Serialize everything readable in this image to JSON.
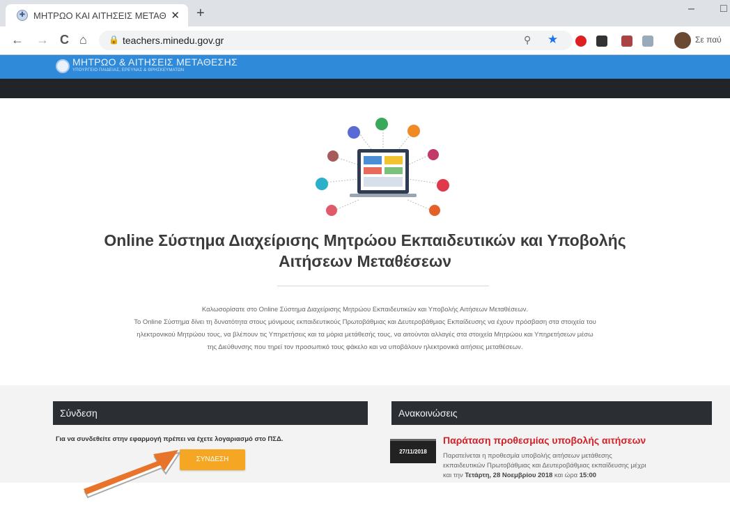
{
  "browser": {
    "tab_title": "ΜΗΤΡΩΟ ΚΑΙ ΑΙΤΗΣΕΙΣ ΜΕΤΑΘΕ",
    "tab_close": "✕",
    "new_tab": "+",
    "minimize": "–",
    "maximize": "□",
    "back": "←",
    "forward": "→",
    "reload": "C",
    "home": "⌂",
    "url": "teachers.minedu.gov.gr",
    "lock": "🔒",
    "search_icon": "⚲",
    "bookmark_star": "★",
    "profile_name": "Σε παύ"
  },
  "site": {
    "header_title": "ΜΗΤΡΩΟ & ΑΙΤΗΣΕΙΣ ΜΕΤΑΘΕΣΗΣ",
    "header_subtitle": "ΥΠΟΥΡΓΕΙΟ ΠΑΙΔΕΙΑΣ, ΕΡΕΥΝΑΣ & ΘΡΗΣΚΕΥΜΑΤΩΝ",
    "title_line1": "Online Σύστημα Διαχείρισης Μητρώου Εκπαιδευτικών και Υποβολής",
    "title_line2": "Αιτήσεων Μεταθέσεων",
    "welcome": [
      "Καλωσορίσατε στο Online Σύστημα Διαχείρισης Μητρώου Εκπαιδευτικών και Υποβολής Αιτήσεων Μεταθέσεων.",
      "Το Online Σύστημα δίνει τη δυνατότητα στους μόνιμους εκπαιδευτικούς Πρωτοβάθμιας και Δευτεροβάθμιας Εκπαίδευσης να έχουν πρόσβαση στα στοιχεία του",
      "ηλεκτρονικού Μητρώου τους, να βλέπουν τις Υπηρετήσεις και τα μόρια μετάθεσής τους, να αιτούνται αλλαγές στα στοιχεία Μητρώου και Υπηρετήσεων μέσω",
      "της Διεύθυνσης που τηρεί τον προσωπικό τους φάκελο και να υποβάλουν ηλεκτρονικά αιτήσεις μεταθέσεων."
    ]
  },
  "login": {
    "heading": "Σύνδεση",
    "message": "Για να συνδεθείτε στην εφαρμογή πρέπει να έχετε λογαριασμό στο ΠΣΔ.",
    "button": "ΣΥΝΔΕΣΗ"
  },
  "news": {
    "heading": "Ανακοινώσεις",
    "date": "27/11/2018",
    "title": "Παράταση προθεσμίας υποβολής αιτήσεων",
    "body_line1": "Παρατείνεται η προθεσμία υποβολής αιτήσεων μετάθεσης",
    "body_line2": "εκπαιδευτικών Πρωτοβάθμιας και Δευτεροβάθμιας εκπαίδευσης μέχρι",
    "body_line3_pre": "και την ",
    "body_line3_bold": "Τετάρτη, 28 Νοεμβρίου 2018",
    "body_line3_mid": " και ώρα ",
    "body_line3_time": "15:00"
  },
  "colors": {
    "header_blue": "#2f8ad9",
    "dark_bar": "#21252a",
    "login_button": "#f5a623",
    "news_title": "#d41f26",
    "arrow": "#e8732a"
  }
}
